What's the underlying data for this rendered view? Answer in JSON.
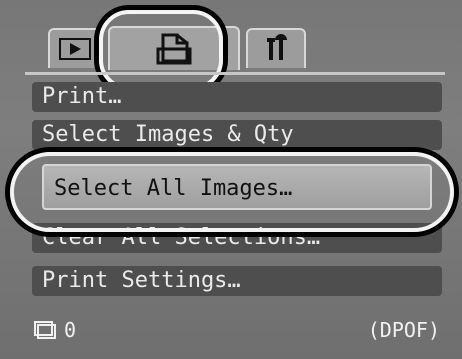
{
  "tabs": {
    "play": {
      "icon": "play-icon"
    },
    "print": {
      "icon": "print-icon"
    },
    "setup": {
      "icon": "wrench-hammer-icon"
    }
  },
  "menu": {
    "items": [
      {
        "label": "Print…"
      },
      {
        "label": "Select Images & Qty"
      },
      {
        "label": "Select All Images…"
      },
      {
        "label": "Clear All Selections…"
      },
      {
        "label": "Print Settings…"
      }
    ]
  },
  "status": {
    "count": "0",
    "mode": "(DPOF)"
  },
  "colors": {
    "accent": "#f4f4f4",
    "menu_bg": "#4e4e4e",
    "selected_bg": "#b0b0b0"
  }
}
